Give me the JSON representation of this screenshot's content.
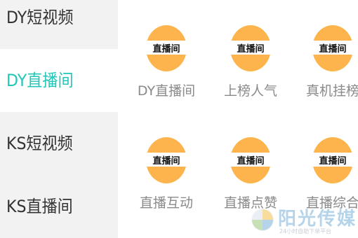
{
  "sidebar": {
    "items": [
      {
        "label": "DY短视频",
        "active": false
      },
      {
        "label": "DY直播间",
        "active": true
      },
      {
        "label": "KS短视频",
        "active": false
      },
      {
        "label": "KS直播间",
        "active": false
      }
    ]
  },
  "grid": {
    "badge_text": "直播间",
    "tiles": [
      {
        "label": "DY直播间"
      },
      {
        "label": "上榜人气"
      },
      {
        "label": "真机挂榜"
      },
      {
        "label": "直播互动"
      },
      {
        "label": "直播点赞"
      },
      {
        "label": "直播综合"
      }
    ]
  },
  "watermark": {
    "title": "阳光传媒",
    "subtitle": "24小时自助下单平台"
  },
  "colors": {
    "accent": "#21c6b8",
    "badge_orange": "#fdb44c",
    "sidebar_bg": "#f2f2f2",
    "label_gray": "#8a8a8a"
  }
}
